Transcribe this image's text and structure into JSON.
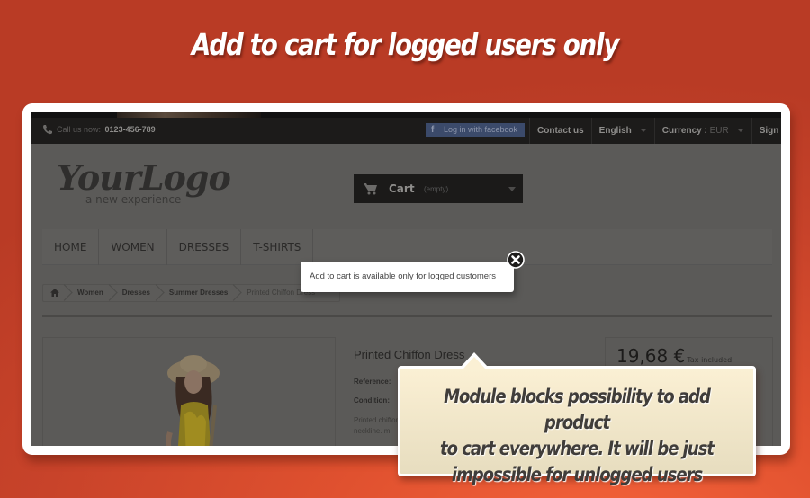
{
  "headline": "Add to cart for logged users only",
  "shop": {
    "topbar": {
      "call_label": "Call us now:",
      "phone": "0123-456-789",
      "facebook_login": "Log in with facebook",
      "contact": "Contact us",
      "language": "English",
      "currency_label": "Currency :",
      "currency_value": "EUR",
      "sign_in": "Sign in"
    },
    "logo": {
      "name": "YourLogo",
      "tagline": "a new experience"
    },
    "cart": {
      "label": "Cart",
      "status": "(empty)"
    },
    "menu": [
      "HOME",
      "WOMEN",
      "DRESSES",
      "T-SHIRTS"
    ],
    "breadcrumb": [
      "Women",
      "Dresses",
      "Summer Dresses",
      "Printed Chiffon Dress"
    ],
    "product": {
      "title": "Printed Chiffon Dress",
      "reference_label": "Reference:",
      "condition_label": "Condition:",
      "description": [
        "Printed chiffon",
        "neckline. m"
      ],
      "price": "19,68 €",
      "tax_note": "Tax included"
    },
    "popup": {
      "message": "Add to cart is available only for logged customers"
    }
  },
  "callout": {
    "lines": [
      "Module blocks possibility to add product",
      "to cart everywhere. It will be just",
      "impossible for unlogged users"
    ]
  }
}
